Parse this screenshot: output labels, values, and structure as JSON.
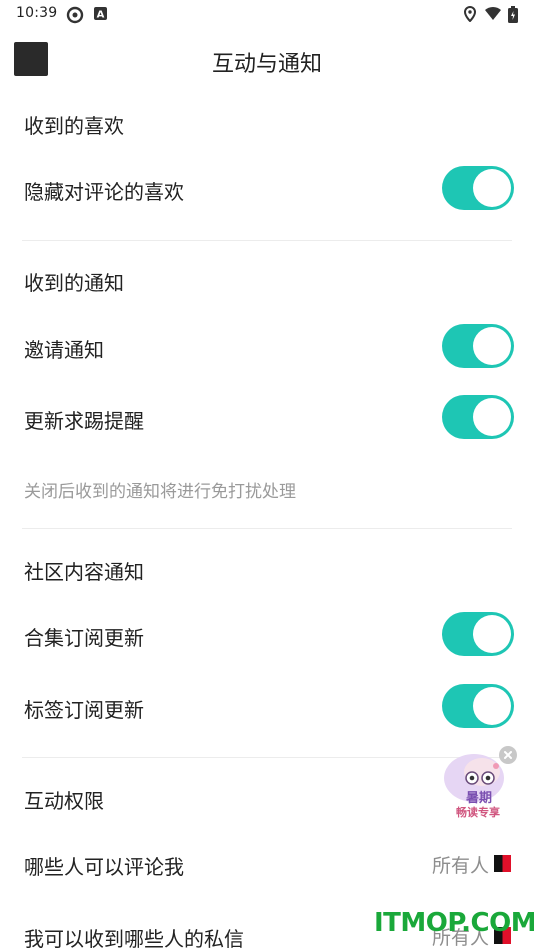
{
  "status_bar": {
    "time": "10:39",
    "icons": [
      "vpn-icon",
      "keyboard-a-icon",
      "location-icon",
      "wifi-icon",
      "battery-icon"
    ]
  },
  "header": {
    "title": "互动与通知"
  },
  "sections": {
    "likes": {
      "title": "收到的喜欢",
      "rows": [
        {
          "label": "隐藏对评论的喜欢",
          "toggle": true
        }
      ]
    },
    "notifications": {
      "title": "收到的通知",
      "rows": [
        {
          "label": "邀请通知",
          "toggle": true
        },
        {
          "label": "更新求踢提醒",
          "toggle": true
        }
      ],
      "hint": "关闭后收到的通知将进行免打扰处理"
    },
    "community": {
      "title": "社区内容通知",
      "rows": [
        {
          "label": "合集订阅更新",
          "toggle": true
        },
        {
          "label": "标签订阅更新",
          "toggle": true
        }
      ]
    },
    "permissions": {
      "title": "互动权限",
      "rows": [
        {
          "label": "哪些人可以评论我",
          "value": "所有人"
        },
        {
          "label": "我可以收到哪些人的私信",
          "value": "所有人"
        }
      ]
    }
  },
  "promo": {
    "text_line1": "暑期",
    "text_line2": "畅读专享"
  },
  "watermark": "ITMOP.COM",
  "colors": {
    "accent": "#1ec6b4",
    "text_primary": "#222222",
    "text_secondary": "#9a9a9a",
    "divider": "#ececec"
  }
}
